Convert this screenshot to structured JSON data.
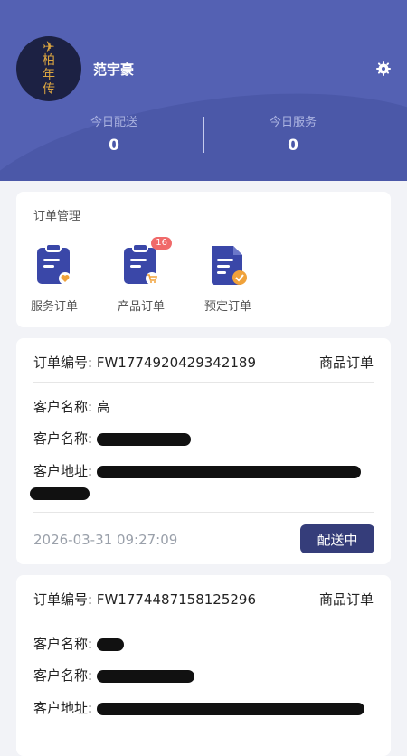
{
  "header": {
    "avatar_text": [
      "柏",
      "年",
      "传"
    ],
    "username": "范宇豪",
    "stats": [
      {
        "label": "今日配送",
        "value": "0"
      },
      {
        "label": "今日服务",
        "value": "0"
      }
    ]
  },
  "management": {
    "title": "订单管理",
    "items": [
      {
        "label": "服务订单",
        "icon": "clipboard-heart-icon",
        "badge": ""
      },
      {
        "label": "产品订单",
        "icon": "clipboard-cart-icon",
        "badge": "16"
      },
      {
        "label": "预定订单",
        "icon": "document-check-icon",
        "badge": ""
      }
    ]
  },
  "orders": [
    {
      "number_label": "订单编号:",
      "number": "FW1774920429342189",
      "type": "商品订单",
      "customer_name_label": "客户名称:",
      "customer_name": "高",
      "customer_phone_label": "客户名称:",
      "customer_address_label": "客户地址:",
      "date": "2026-03-31 09:27:09",
      "status": "配送中"
    },
    {
      "number_label": "订单编号:",
      "number": "FW1774487158125296",
      "type": "商品订单",
      "customer_name_label": "客户名称:",
      "customer_phone_label": "客户名称:",
      "customer_address_label": "客户地址:"
    }
  ],
  "colors": {
    "header_bg": "#5461b3",
    "status_button": "#353d7a",
    "badge": "#f06a6a",
    "icon_blue": "#3a47a8",
    "icon_accent": "#f0a23a"
  }
}
